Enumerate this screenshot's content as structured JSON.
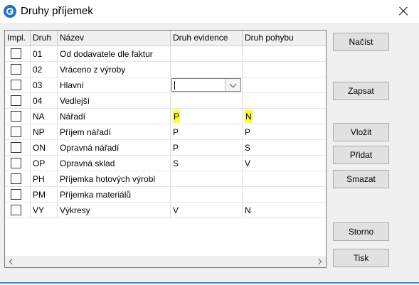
{
  "window": {
    "title": "Druhy příjemek",
    "app_icon": "app-logo-icon",
    "close_icon": "close-icon"
  },
  "grid": {
    "columns": [
      "Impl.",
      "Druh",
      "Název",
      "Druh evidence",
      "Druh pohybu"
    ],
    "rows": [
      {
        "impl": false,
        "druh": "01",
        "nazev": "Od dodavatele dle faktur",
        "evidence": "",
        "pohyb": "",
        "highlight": false
      },
      {
        "impl": false,
        "druh": "02",
        "nazev": "Vráceno z výroby",
        "evidence": "",
        "pohyb": "",
        "highlight": false
      },
      {
        "impl": false,
        "druh": "03",
        "nazev": "Hlavní",
        "evidence": "",
        "pohyb": "",
        "highlight": false,
        "editing": true
      },
      {
        "impl": false,
        "druh": "04",
        "nazev": "Vedlejší",
        "evidence": "",
        "pohyb": "",
        "highlight": false
      },
      {
        "impl": false,
        "druh": "NA",
        "nazev": "Nářadí",
        "evidence": "P",
        "pohyb": "N",
        "highlight": true
      },
      {
        "impl": false,
        "druh": "NP",
        "nazev": "Příjem nářadí",
        "evidence": "P",
        "pohyb": "P",
        "highlight": false
      },
      {
        "impl": false,
        "druh": "ON",
        "nazev": "Opravná nářadí",
        "evidence": "P",
        "pohyb": "S",
        "highlight": false
      },
      {
        "impl": false,
        "druh": "OP",
        "nazev": "Opravná sklad",
        "evidence": "S",
        "pohyb": "V",
        "highlight": false
      },
      {
        "impl": false,
        "druh": "PH",
        "nazev": "Příjemka hotových výrobl",
        "evidence": "",
        "pohyb": "",
        "highlight": false
      },
      {
        "impl": false,
        "druh": "PM",
        "nazev": "Příjemka materiálů",
        "evidence": "",
        "pohyb": "",
        "highlight": false
      },
      {
        "impl": false,
        "druh": "VY",
        "nazev": "Výkresy",
        "evidence": "V",
        "pohyb": "N",
        "highlight": false
      }
    ],
    "editor": {
      "value": "",
      "dropdown_icon": "chevron-down-icon"
    },
    "highlight_color": "#ffff29"
  },
  "buttons": {
    "nacist": "Načíst",
    "zapsat": "Zapsat",
    "vlozit": "Vložit",
    "pridat": "Přidat",
    "smazat": "Smazat",
    "storno": "Storno",
    "tisk": "Tisk"
  },
  "colors": {
    "accent": "#1e73c8",
    "border_bottom": "#3c8cd6"
  }
}
